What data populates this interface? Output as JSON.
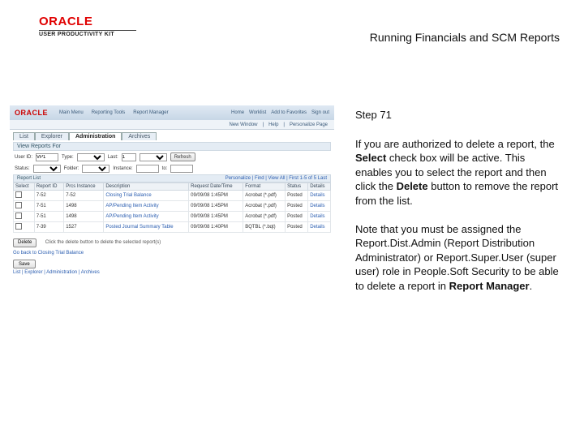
{
  "header": {
    "logo_text": "ORACLE",
    "logo_sub": "USER PRODUCTIVITY KIT",
    "doc_title": "Running Financials and SCM Reports"
  },
  "app": {
    "brand": "ORACLE",
    "menu": [
      "Main Menu",
      "Reporting Tools",
      "Report Manager"
    ],
    "right_links": [
      "Home",
      "Worklist",
      "Add to Favorites",
      "Sign out"
    ],
    "subbar": [
      "New Window",
      "Help",
      "Personalize Page"
    ],
    "tabs": [
      "List",
      "Explorer",
      "Administration",
      "Archives"
    ],
    "tab_selected": "Administration",
    "section_title": "View Reports For",
    "filters": {
      "userid_label": "User ID:",
      "userid_value": "VP1",
      "type_label": "Type:",
      "last_label": "Last:",
      "last_value": "1",
      "status_label": "Status:",
      "folder_label": "Folder:",
      "instance_label": "Instance:",
      "to_label": "to:",
      "refresh": "Refresh"
    },
    "grid_title": "Report List",
    "grid_nav": "Personalize | Find | View All | First 1-5 of 5 Last",
    "columns": [
      "Select",
      "Report ID",
      "Prcs Instance",
      "Description",
      "Request Date/Time",
      "Format",
      "Status",
      "Details"
    ],
    "rows": [
      {
        "rid": "7-52",
        "pi": "7-52",
        "desc": "Closing Trial Balance",
        "dt": "09/09/08 1:45PM",
        "fmt": "Acrobat (*.pdf)",
        "status": "Posted",
        "det": "Details"
      },
      {
        "rid": "7-51",
        "pi": "1498",
        "desc": "AP/Pending Item Activity",
        "dt": "09/09/08 1:45PM",
        "fmt": "Acrobat (*.pdf)",
        "status": "Posted",
        "det": "Details"
      },
      {
        "rid": "7-51",
        "pi": "1498",
        "desc": "AP/Pending Item Activity",
        "dt": "09/09/08 1:45PM",
        "fmt": "Acrobat (*.pdf)",
        "status": "Posted",
        "det": "Details"
      },
      {
        "rid": "7-39",
        "pi": "1527",
        "desc": "Posted Journal Summary Table",
        "dt": "09/09/08 1:40PM",
        "fmt": "BQTBL (*.bqt)",
        "status": "Posted",
        "det": "Details"
      }
    ],
    "delete_btn": "Delete",
    "delete_note": "Click the delete button to delete the selected report(s)",
    "goback_link": "Go back to Closing Trial Balance",
    "save_btn": "Save",
    "bottom_tabs": "List | Explorer | Administration | Archives"
  },
  "right": {
    "step": "Step 71",
    "p1a": "If you are authorized to delete a report, the ",
    "p1b": "Select",
    "p1c": " check box will be active. This enables you to select the report and then click the ",
    "p1d": "Delete",
    "p1e": " button to remove the report from the list.",
    "p2a": "Note that you must be assigned the Report.Dist.Admin (Report Distribution Administrator) or Report.Super.User (super user) role in People.Soft Security to be able to delete a report in ",
    "p2b": "Report Manager",
    "p2c": "."
  }
}
